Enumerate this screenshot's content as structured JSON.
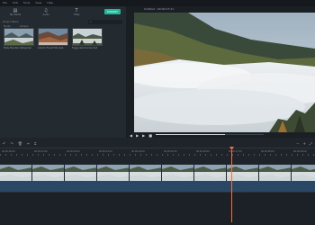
{
  "menu": [
    "File",
    "Edit",
    "Tools",
    "View",
    "Help"
  ],
  "tabs": [
    {
      "icon": "folder-icon",
      "glyph": "▤",
      "label": "My Media"
    },
    {
      "icon": "music-icon",
      "glyph": "♫",
      "label": "Audio"
    },
    {
      "icon": "title-icon",
      "glyph": "T",
      "label": "Titles"
    }
  ],
  "export_label": "EXPORT",
  "project_media_label": "Project Media",
  "filter_tabs": [
    "Media",
    "Sample"
  ],
  "media": [
    {
      "label": "Misty Mountain Valley.mp4"
    },
    {
      "label": "Autumn Forest Hills.mp4"
    },
    {
      "label": "Foggy Lake Sunrise.mp4"
    }
  ],
  "preview": {
    "title": "Untitled : 00:00:07:21",
    "progress": 0.64
  },
  "timeline_ticks": [
    "00:00:00:00",
    "00:00:01:00",
    "00:00:02:00",
    "00:00:03:00",
    "00:00:04:00",
    "00:00:05:00",
    "00:00:06:00",
    "00:00:07:00",
    "00:00:08:00",
    "00:00:09:00"
  ],
  "colors": {
    "accent": "#1fb89a",
    "playhead": "#ff6b38",
    "audio": "#2a4866"
  }
}
